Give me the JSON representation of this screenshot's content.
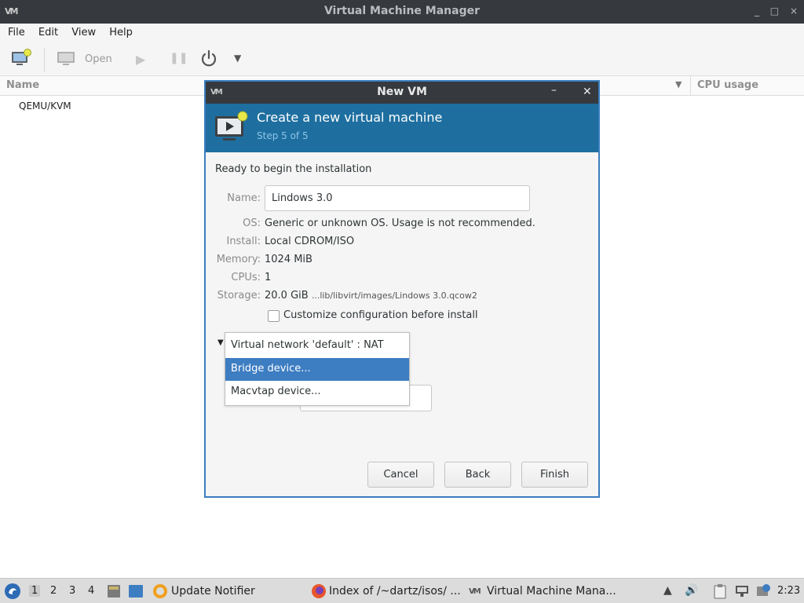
{
  "window": {
    "title": "Virtual Machine Manager",
    "logo_text": "VM",
    "controls": [
      "_",
      "□",
      "×"
    ]
  },
  "menu": [
    "File",
    "Edit",
    "View",
    "Help"
  ],
  "toolbar": {
    "open_label": "Open"
  },
  "list": {
    "col_name": "Name",
    "col_cpu": "CPU usage",
    "connection": "QEMU/KVM"
  },
  "dialog": {
    "title": "New VM",
    "logo_text": "VM",
    "min": "–",
    "close": "✕",
    "banner_title": "Create a new virtual machine",
    "banner_step": "Step 5 of 5",
    "ready": "Ready to begin the installation",
    "name_label": "Name:",
    "name_value": "Lindows 3.0",
    "os_label": "OS:",
    "os_value": "Generic or unknown OS. Usage is not recommended.",
    "install_label": "Install:",
    "install_value": "Local CDROM/ISO",
    "memory_label": "Memory:",
    "memory_value": "1024 MiB",
    "cpus_label": "CPUs:",
    "cpus_value": "1",
    "storage_label": "Storage:",
    "storage_size": "20.0 GiB",
    "storage_path": "...lib/libvirt/images/Lindows 3.0.qcow2",
    "customize_label": "Customize configuration before install",
    "customize_checked": false,
    "network_options": [
      "Virtual network 'default' : NAT",
      "Bridge device...",
      "Macvtap device..."
    ],
    "network_selected_index": 1,
    "cancel": "Cancel",
    "back": "Back",
    "finish": "Finish"
  },
  "taskbar": {
    "workspaces": [
      "1",
      "2",
      "3",
      "4"
    ],
    "active_workspace": "1",
    "update_notifier": "Update Notifier",
    "firefox_task": "Index of /~dartz/isos/ ...",
    "vmm_task": "Virtual Machine Mana...",
    "clock": "2:23"
  },
  "colors": {
    "banner": "#1e6fa0",
    "selection": "#3d7dc2",
    "dialog_border": "#3a7ebf",
    "titlebar": "#363a3f"
  }
}
